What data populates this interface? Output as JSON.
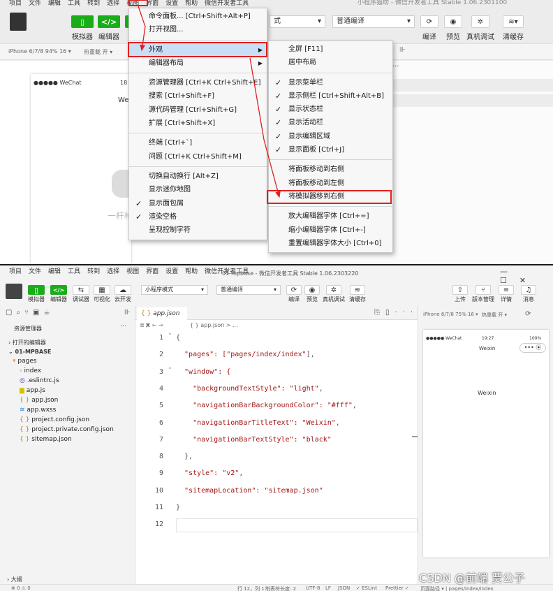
{
  "top": {
    "menubar": [
      "项目",
      "文件",
      "编辑",
      "工具",
      "转到",
      "选择",
      "视图",
      "界面",
      "设置",
      "帮助",
      "微信开发者工具"
    ],
    "window_title": "小程序猫助 - 微信开发者工具 Stable 1.06.2301100",
    "toolbar": {
      "simulator": "模拟器",
      "editor": "编辑器",
      "compile_mode": "普通编译",
      "compile": "编译",
      "preview": "预览",
      "remote_debug": "真机调试",
      "clear_cache": "清缓存",
      "mode_partial": "式"
    },
    "device": "iPhone 6/7/8 94% 16 ▾",
    "hot_reload": "热重载 开 ▾",
    "phone": {
      "carrier": "●●●●● WeChat",
      "time": "18",
      "title": "We",
      "avatar_caption": "一杆枪"
    },
    "view_menu": {
      "items": [
        {
          "label": "命令面板...  [Ctrl+Shift+Alt+P]"
        },
        {
          "label": "打开视图..."
        },
        {
          "sep": true
        },
        {
          "label": "外观",
          "submenu": true,
          "highlight": true
        },
        {
          "label": "编辑器布局",
          "submenu": true
        },
        {
          "sep": true
        },
        {
          "label": "资源管理器  [Ctrl+K Ctrl+Shift+E]"
        },
        {
          "label": "搜索  [Ctrl+Shift+F]"
        },
        {
          "label": "源代码管理  [Ctrl+Shift+G]"
        },
        {
          "label": "扩展  [Ctrl+Shift+X]"
        },
        {
          "sep": true
        },
        {
          "label": "终端  [Ctrl+`]"
        },
        {
          "label": "问题  [Ctrl+K Ctrl+Shift+M]"
        },
        {
          "sep": true
        },
        {
          "label": "切换自动换行  [Alt+Z]"
        },
        {
          "label": "显示迷你地图"
        },
        {
          "label": "显示面包屑",
          "checked": true
        },
        {
          "label": "渲染空格",
          "checked": true
        },
        {
          "label": "呈现控制字符"
        }
      ]
    },
    "appearance_menu": {
      "items": [
        {
          "label": "全屏  [F11]"
        },
        {
          "label": "居中布局"
        },
        {
          "sep": true
        },
        {
          "label": "显示菜单栏",
          "checked": true
        },
        {
          "label": "显示侧栏  [Ctrl+Shift+Alt+B]",
          "checked": true
        },
        {
          "label": "显示状态栏",
          "checked": true
        },
        {
          "label": "显示活动栏",
          "checked": true
        },
        {
          "label": "显示编辑区域",
          "checked": true
        },
        {
          "label": "显示面板  [Ctrl+J]",
          "checked": true
        },
        {
          "sep": true
        },
        {
          "label": "将面板移动到右侧"
        },
        {
          "label": "将面板移动到左侧"
        },
        {
          "label": "将模拟器移到右侧",
          "boxed": true
        },
        {
          "sep": true
        },
        {
          "label": "放大编辑器字体  [Ctrl+=]"
        },
        {
          "label": "缩小编辑器字体  [Ctrl+-]"
        },
        {
          "label": "重置编辑器字体大小  [Ctrl+0]"
        }
      ]
    },
    "menu_view_label": "视图"
  },
  "bottom": {
    "menubar": [
      "项目",
      "文件",
      "编辑",
      "工具",
      "转到",
      "选择",
      "视图",
      "界面",
      "设置",
      "帮助",
      "微信开发者工具"
    ],
    "title": "01-mpbase - 微信开发者工具 Stable 1.06.2303220",
    "toolbar": {
      "simulator": "模拟器",
      "editor": "编辑器",
      "debugger": "调试器",
      "visual": "可视化",
      "cloud": "云开发",
      "mode": "小程序模式",
      "compile_mode": "普通编译",
      "compile": "编译",
      "preview": "预览",
      "remote_debug": "真机调试",
      "clear_cache": "清缓存",
      "upload": "上传",
      "version": "版本管理",
      "details": "详情",
      "messages": "消息"
    },
    "explorer": {
      "title": "资源管理器",
      "open_editors": "打开的编辑器",
      "project": "01-MPBASE",
      "files": [
        "pages",
        "index",
        ".eslintrc.js",
        "app.js",
        "app.json",
        "app.wxss",
        "project.config.json",
        "project.private.config.json",
        "sitemap.json"
      ],
      "outline": "大纲",
      "status": "⊗ 0 ⚠ 0"
    },
    "editor": {
      "tab": "app.json",
      "breadcrumb": "{ } app.json > ...",
      "lines": [
        [
          [
            "{",
            "p"
          ]
        ],
        [
          [
            "  \"pages\": [",
            "k"
          ],
          [
            "\"pages/index/index\"",
            "s"
          ],
          [
            "],",
            "p"
          ]
        ],
        [
          [
            "  \"window\": {",
            "k"
          ]
        ],
        [
          [
            "    \"backgroundTextStyle\": ",
            "k"
          ],
          [
            "\"light\"",
            "s"
          ],
          [
            ",",
            "p"
          ]
        ],
        [
          [
            "    \"navigationBarBackgroundColor\": ",
            "k"
          ],
          [
            "\"#fff\"",
            "s"
          ],
          [
            ",",
            "p"
          ]
        ],
        [
          [
            "    \"navigationBarTitleText\": ",
            "k"
          ],
          [
            "\"Weixin\"",
            "s"
          ],
          [
            ",",
            "p"
          ]
        ],
        [
          [
            "    \"navigationBarTextStyle\": ",
            "k"
          ],
          [
            "\"black\"",
            "s"
          ]
        ],
        [
          [
            "  },",
            "p"
          ]
        ],
        [
          [
            "  \"style\": ",
            "k"
          ],
          [
            "\"v2\"",
            "s"
          ],
          [
            ",",
            "p"
          ]
        ],
        [
          [
            "  \"sitemapLocation\": ",
            "k"
          ],
          [
            "\"sitemap.json\"",
            "s"
          ]
        ],
        [
          [
            "}",
            "p"
          ]
        ],
        [
          [
            "",
            "p"
          ]
        ]
      ]
    },
    "simulator": {
      "device": "iPhone 6/7/8 75% 16 ▾",
      "hot_reload": "热重载 开 ▾",
      "carrier": "●●●●● WeChat",
      "time": "19:27",
      "battery": "100%",
      "nav_title": "Weixin",
      "body_text": "Weixin"
    },
    "status": {
      "pos": "行 12，列 1",
      "indent": "制表符长度: 2",
      "enc": "UTF-8",
      "eol": "LF",
      "lang": "JSON",
      "eslint": "✓ ESLint",
      "prettier": "Prettier ✓",
      "page_path": "页面路径 ▾ | pages/index/index"
    }
  },
  "watermark": "CSDN @前端 贾公子",
  "colors": {
    "key": "#a31515",
    "str": "#a31515",
    "green": "#1aad19",
    "red": "#e02020",
    "highlight": "#c9dff5"
  }
}
